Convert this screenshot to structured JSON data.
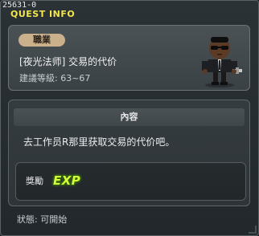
{
  "window": {
    "quest_id": "25631-0",
    "title": "QUEST INFO"
  },
  "header": {
    "job_label": "職業",
    "quest_name": "[夜光法师] 交易的代价",
    "recommended_level": "建議等級: 63~67",
    "npc_icon": "npc-portrait"
  },
  "content": {
    "header_label": "內容",
    "description": "去工作员R那里获取交易的代价吧。",
    "reward": {
      "label": "獎勵",
      "exp_text": "EXP"
    }
  },
  "status": {
    "text": "狀態:  可開始"
  },
  "colors": {
    "title": "#f3e64a",
    "job_badge": "#cbb08c",
    "exp": "#d7ff36"
  }
}
